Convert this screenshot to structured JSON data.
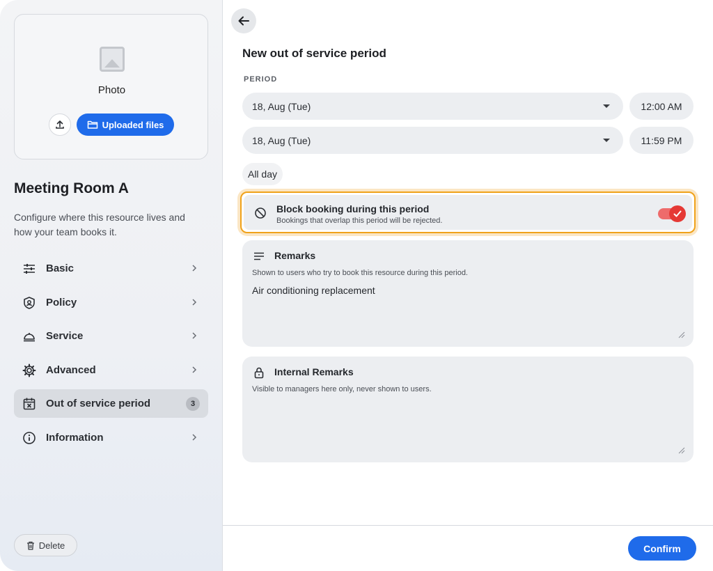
{
  "sidebar": {
    "photo": {
      "label": "Photo",
      "uploaded_files_label": "Uploaded files"
    },
    "resource_name": "Meeting Room A",
    "resource_description": "Configure where this resource lives and how your team books it.",
    "nav_items": [
      {
        "label": "Basic",
        "icon": "sliders-icon"
      },
      {
        "label": "Policy",
        "icon": "shield-icon"
      },
      {
        "label": "Service",
        "icon": "service-bell-icon"
      },
      {
        "label": "Advanced",
        "icon": "gear-icon"
      },
      {
        "label": "Out of service period",
        "icon": "calendar-x-icon",
        "badge": "3",
        "active": true
      },
      {
        "label": "Information",
        "icon": "info-icon"
      }
    ],
    "delete_label": "Delete"
  },
  "main": {
    "title": "New out of service period",
    "period_label": "PERIOD",
    "start_date": "18, Aug (Tue)",
    "start_time": "12:00 AM",
    "end_date": "18, Aug (Tue)",
    "end_time": "11:59 PM",
    "all_day_label": "All day",
    "block_booking": {
      "title": "Block booking during this period",
      "subtitle": "Bookings that overlap this period will be rejected.",
      "enabled": true
    },
    "remarks": {
      "title": "Remarks",
      "subtitle": "Shown to users who try to book this resource during this period.",
      "value": "Air conditioning replacement"
    },
    "internal_remarks": {
      "title": "Internal Remarks",
      "subtitle": "Visible to managers here only, never shown to users.",
      "value": ""
    },
    "confirm_label": "Confirm"
  },
  "colors": {
    "accent": "#1f6bea",
    "toggle_on": "#e53935",
    "highlight_border": "#f0a21a"
  }
}
